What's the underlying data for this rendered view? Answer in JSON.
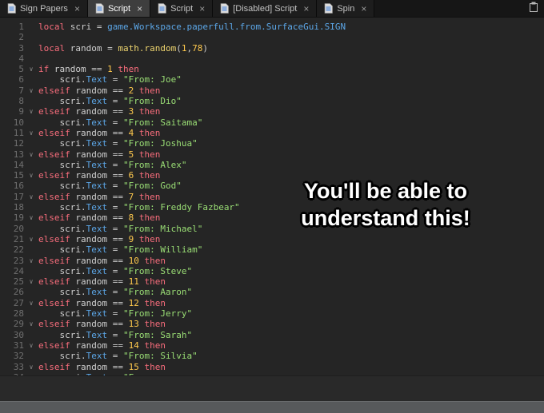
{
  "window": {
    "tabs": [
      {
        "label": "Sign Papers",
        "active": false
      },
      {
        "label": "Script",
        "active": true
      },
      {
        "label": "Script",
        "active": false
      },
      {
        "label": "[Disabled] Script",
        "active": false
      },
      {
        "label": "Spin",
        "active": false
      }
    ],
    "close_glyph": "×"
  },
  "overlay": {
    "line1": "You'll be able to",
    "line2": "understand this!"
  },
  "colors": {
    "background": "#252525",
    "text": "#cfcfcf",
    "keyword": "#f86d7c",
    "string": "#9ade75",
    "number": "#ffc94d",
    "builtin": "#ecd36e",
    "property": "#5ca7e8",
    "line_number": "#6f6f6f"
  },
  "editor": {
    "fold_glyph": "∨",
    "lines": [
      {
        "n": 1,
        "tokens": [
          [
            "kw",
            "local"
          ],
          [
            "pl",
            " scri = "
          ],
          [
            "bl",
            "game.Workspace.paperfull.from.SurfaceGui.SIGN"
          ]
        ]
      },
      {
        "n": 2,
        "tokens": []
      },
      {
        "n": 3,
        "tokens": [
          [
            "kw",
            "local"
          ],
          [
            "pl",
            " random = "
          ],
          [
            "fn",
            "math.random"
          ],
          [
            "pl",
            "("
          ],
          [
            "nu",
            "1"
          ],
          [
            "pl",
            ","
          ],
          [
            "nu",
            "78"
          ],
          [
            "pl",
            ")"
          ]
        ]
      },
      {
        "n": 4,
        "tokens": []
      },
      {
        "n": 5,
        "fold": true,
        "tokens": [
          [
            "kw",
            "if"
          ],
          [
            "pl",
            " random == "
          ],
          [
            "nu",
            "1"
          ],
          [
            "kw",
            " then"
          ]
        ]
      },
      {
        "n": 6,
        "tokens": [
          [
            "pl",
            "    scri."
          ],
          [
            "bl",
            "Text"
          ],
          [
            "pl",
            " = "
          ],
          [
            "st",
            "\"From: Joe\""
          ]
        ]
      },
      {
        "n": 7,
        "fold": true,
        "tokens": [
          [
            "kw",
            "elseif"
          ],
          [
            "pl",
            " random == "
          ],
          [
            "nu",
            "2"
          ],
          [
            "kw",
            " then"
          ]
        ]
      },
      {
        "n": 8,
        "tokens": [
          [
            "pl",
            "    scri."
          ],
          [
            "bl",
            "Text"
          ],
          [
            "pl",
            " = "
          ],
          [
            "st",
            "\"From: Dio\""
          ]
        ]
      },
      {
        "n": 9,
        "fold": true,
        "tokens": [
          [
            "kw",
            "elseif"
          ],
          [
            "pl",
            " random == "
          ],
          [
            "nu",
            "3"
          ],
          [
            "kw",
            " then"
          ]
        ]
      },
      {
        "n": 10,
        "tokens": [
          [
            "pl",
            "    scri."
          ],
          [
            "bl",
            "Text"
          ],
          [
            "pl",
            " = "
          ],
          [
            "st",
            "\"From: Saitama\""
          ]
        ]
      },
      {
        "n": 11,
        "fold": true,
        "tokens": [
          [
            "kw",
            "elseif"
          ],
          [
            "pl",
            " random == "
          ],
          [
            "nu",
            "4"
          ],
          [
            "kw",
            " then"
          ]
        ]
      },
      {
        "n": 12,
        "tokens": [
          [
            "pl",
            "    scri."
          ],
          [
            "bl",
            "Text"
          ],
          [
            "pl",
            " = "
          ],
          [
            "st",
            "\"From: Joshua\""
          ]
        ]
      },
      {
        "n": 13,
        "fold": true,
        "tokens": [
          [
            "kw",
            "elseif"
          ],
          [
            "pl",
            " random == "
          ],
          [
            "nu",
            "5"
          ],
          [
            "kw",
            " then"
          ]
        ]
      },
      {
        "n": 14,
        "tokens": [
          [
            "pl",
            "    scri."
          ],
          [
            "bl",
            "Text"
          ],
          [
            "pl",
            " = "
          ],
          [
            "st",
            "\"From: Alex\""
          ]
        ]
      },
      {
        "n": 15,
        "fold": true,
        "tokens": [
          [
            "kw",
            "elseif"
          ],
          [
            "pl",
            " random == "
          ],
          [
            "nu",
            "6"
          ],
          [
            "kw",
            " then"
          ]
        ]
      },
      {
        "n": 16,
        "tokens": [
          [
            "pl",
            "    scri."
          ],
          [
            "bl",
            "Text"
          ],
          [
            "pl",
            " = "
          ],
          [
            "st",
            "\"From: God\""
          ]
        ]
      },
      {
        "n": 17,
        "fold": true,
        "tokens": [
          [
            "kw",
            "elseif"
          ],
          [
            "pl",
            " random == "
          ],
          [
            "nu",
            "7"
          ],
          [
            "kw",
            " then"
          ]
        ]
      },
      {
        "n": 18,
        "tokens": [
          [
            "pl",
            "    scri."
          ],
          [
            "bl",
            "Text"
          ],
          [
            "pl",
            " = "
          ],
          [
            "st",
            "\"From: Freddy Fazbear\""
          ]
        ]
      },
      {
        "n": 19,
        "fold": true,
        "tokens": [
          [
            "kw",
            "elseif"
          ],
          [
            "pl",
            " random == "
          ],
          [
            "nu",
            "8"
          ],
          [
            "kw",
            " then"
          ]
        ]
      },
      {
        "n": 20,
        "tokens": [
          [
            "pl",
            "    scri."
          ],
          [
            "bl",
            "Text"
          ],
          [
            "pl",
            " = "
          ],
          [
            "st",
            "\"From: Michael\""
          ]
        ]
      },
      {
        "n": 21,
        "fold": true,
        "tokens": [
          [
            "kw",
            "elseif"
          ],
          [
            "pl",
            " random == "
          ],
          [
            "nu",
            "9"
          ],
          [
            "kw",
            " then"
          ]
        ]
      },
      {
        "n": 22,
        "tokens": [
          [
            "pl",
            "    scri."
          ],
          [
            "bl",
            "Text"
          ],
          [
            "pl",
            " = "
          ],
          [
            "st",
            "\"From: William\""
          ]
        ]
      },
      {
        "n": 23,
        "fold": true,
        "tokens": [
          [
            "kw",
            "elseif"
          ],
          [
            "pl",
            " random == "
          ],
          [
            "nu",
            "10"
          ],
          [
            "kw",
            " then"
          ]
        ]
      },
      {
        "n": 24,
        "tokens": [
          [
            "pl",
            "    scri."
          ],
          [
            "bl",
            "Text"
          ],
          [
            "pl",
            " = "
          ],
          [
            "st",
            "\"From: Steve\""
          ]
        ]
      },
      {
        "n": 25,
        "fold": true,
        "tokens": [
          [
            "kw",
            "elseif"
          ],
          [
            "pl",
            " random == "
          ],
          [
            "nu",
            "11"
          ],
          [
            "kw",
            " then"
          ]
        ]
      },
      {
        "n": 26,
        "tokens": [
          [
            "pl",
            "    scri."
          ],
          [
            "bl",
            "Text"
          ],
          [
            "pl",
            " = "
          ],
          [
            "st",
            "\"From: Aaron\""
          ]
        ]
      },
      {
        "n": 27,
        "fold": true,
        "tokens": [
          [
            "kw",
            "elseif"
          ],
          [
            "pl",
            " random == "
          ],
          [
            "nu",
            "12"
          ],
          [
            "kw",
            " then"
          ]
        ]
      },
      {
        "n": 28,
        "tokens": [
          [
            "pl",
            "    scri."
          ],
          [
            "bl",
            "Text"
          ],
          [
            "pl",
            " = "
          ],
          [
            "st",
            "\"From: Jerry\""
          ]
        ]
      },
      {
        "n": 29,
        "fold": true,
        "tokens": [
          [
            "kw",
            "elseif"
          ],
          [
            "pl",
            " random == "
          ],
          [
            "nu",
            "13"
          ],
          [
            "kw",
            " then"
          ]
        ]
      },
      {
        "n": 30,
        "tokens": [
          [
            "pl",
            "    scri."
          ],
          [
            "bl",
            "Text"
          ],
          [
            "pl",
            " = "
          ],
          [
            "st",
            "\"From: Sarah\""
          ]
        ]
      },
      {
        "n": 31,
        "fold": true,
        "tokens": [
          [
            "kw",
            "elseif"
          ],
          [
            "pl",
            " random == "
          ],
          [
            "nu",
            "14"
          ],
          [
            "kw",
            " then"
          ]
        ]
      },
      {
        "n": 32,
        "tokens": [
          [
            "pl",
            "    scri."
          ],
          [
            "bl",
            "Text"
          ],
          [
            "pl",
            " = "
          ],
          [
            "st",
            "\"From: Silvia\""
          ]
        ]
      },
      {
        "n": 33,
        "fold": true,
        "tokens": [
          [
            "kw",
            "elseif"
          ],
          [
            "pl",
            " random == "
          ],
          [
            "nu",
            "15"
          ],
          [
            "kw",
            " then"
          ]
        ]
      },
      {
        "n": 34,
        "tokens": [
          [
            "pl",
            "    scri."
          ],
          [
            "bl",
            "Text"
          ],
          [
            "pl",
            " = "
          ],
          [
            "st",
            "\"From: "
          ]
        ]
      }
    ]
  }
}
